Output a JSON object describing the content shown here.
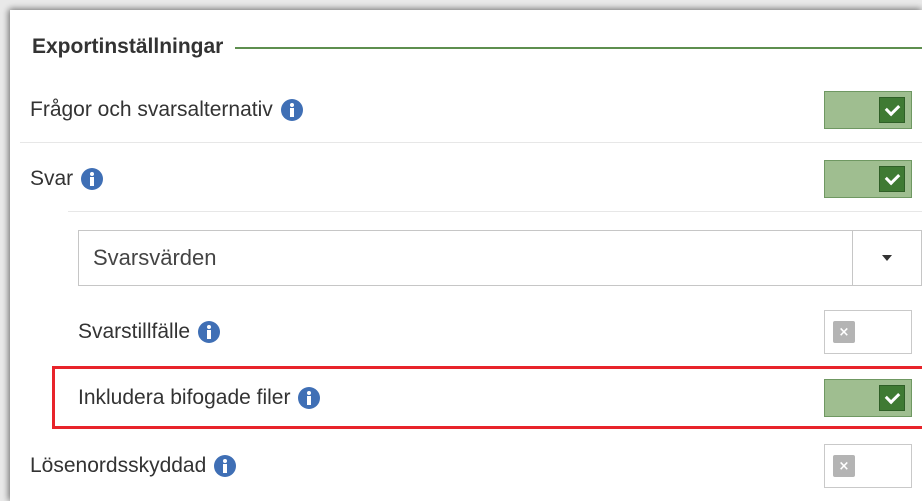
{
  "section": {
    "title": "Exportinställningar"
  },
  "settings": {
    "questions": {
      "label": "Frågor och svarsalternativ",
      "checked": true
    },
    "answers": {
      "label": "Svar",
      "checked": true
    },
    "answer_select": {
      "value": "Svarsvärden"
    },
    "response_occasion": {
      "label": "Svarstillfälle",
      "checked": false
    },
    "include_attachments": {
      "label": "Inkludera bifogade filer",
      "checked": true
    },
    "password_protected": {
      "label": "Lösenordsskyddad",
      "checked": false
    }
  },
  "icons": {
    "info": "info-icon",
    "check": "check-icon",
    "cross": "close-icon",
    "dropdown": "caret-down-icon",
    "cross_glyph": "×"
  },
  "colors": {
    "toggle_on_track": "#9fbe90",
    "toggle_on_knob": "#3f7a33",
    "info_icon": "#3f6fb5",
    "header_line": "#5e8f4f",
    "highlight_border": "#e8232a"
  }
}
